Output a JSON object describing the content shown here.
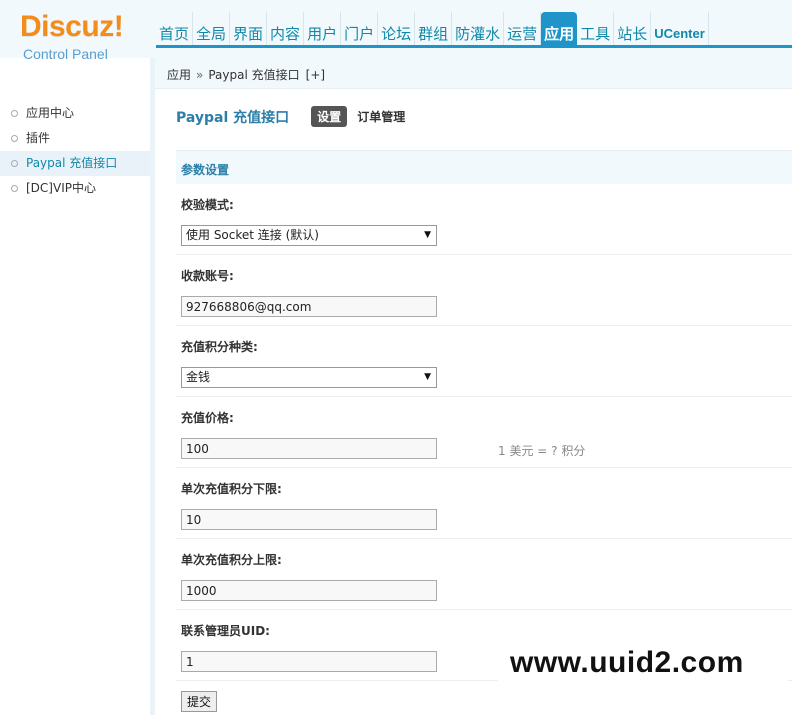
{
  "logo": {
    "brand": "Discuz!",
    "sub": "Control Panel"
  },
  "nav": {
    "items": [
      {
        "label": "首页"
      },
      {
        "label": "全局"
      },
      {
        "label": "界面"
      },
      {
        "label": "内容"
      },
      {
        "label": "用户"
      },
      {
        "label": "门户"
      },
      {
        "label": "论坛"
      },
      {
        "label": "群组"
      },
      {
        "label": "防灌水"
      },
      {
        "label": "运营"
      },
      {
        "label": "应用"
      },
      {
        "label": "工具"
      },
      {
        "label": "站长"
      },
      {
        "label": "UCenter"
      }
    ],
    "active": "应用"
  },
  "breadcrumb": {
    "root": "应用",
    "sep": "»",
    "current": "Paypal 充值接口",
    "add": "[+]"
  },
  "sidebar": {
    "items": [
      {
        "label": "应用中心"
      },
      {
        "label": "插件"
      },
      {
        "label": "Paypal 充值接口"
      },
      {
        "label": "[DC]VIP中心"
      }
    ],
    "active": "Paypal 充值接口"
  },
  "main": {
    "title": "Paypal 充值接口",
    "tabs": [
      {
        "label": "设置"
      },
      {
        "label": "订单管理"
      }
    ],
    "active_tab": "设置",
    "section": "参数设置",
    "fields": [
      {
        "label": "校验模式:",
        "type": "select",
        "value": "使用 Socket 连接 (默认)"
      },
      {
        "label": "收款账号:",
        "type": "input",
        "value": "927668806@qq.com"
      },
      {
        "label": "充值积分种类:",
        "type": "select",
        "value": "金钱"
      },
      {
        "label": "充值价格:",
        "type": "input",
        "value": "100",
        "hint": "1 美元 = ? 积分"
      },
      {
        "label": "单次充值积分下限:",
        "type": "input",
        "value": "10"
      },
      {
        "label": "单次充值积分上限:",
        "type": "input",
        "value": "1000"
      },
      {
        "label": "联系管理员UID:",
        "type": "input",
        "value": "1"
      }
    ],
    "submit": "提交"
  },
  "watermark": "www.uuid2.com",
  "colors": {
    "accent": "#1e94c8",
    "title": "#2b7fa8",
    "logo": "#f48c1b",
    "header_bg": "#f2f9fd"
  }
}
